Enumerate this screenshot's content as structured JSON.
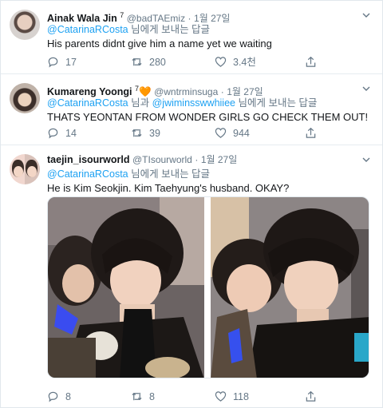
{
  "tweets": [
    {
      "name": "Ainak Wala Jin",
      "name_sup": "7",
      "handle": "@badTAEmiz",
      "date": "1월 27일",
      "reply_mentions": [
        "@CatarinaRCosta"
      ],
      "reply_suffix": "님에게 보내는 답글",
      "text": "His parents didnt give him a name yet we waiting",
      "replies": "17",
      "retweets": "280",
      "likes": "3.4천"
    },
    {
      "name": "Kumareng Yoongi",
      "name_sup": "7",
      "name_emoji": "🧡",
      "handle": "@wntrminsuga",
      "date": "1월 27일",
      "reply_mentions": [
        "@CatarinaRCosta",
        "@jwiminsswwhiiee"
      ],
      "reply_joiner": "님과",
      "reply_suffix": "님에게 보내는 답글",
      "text": "THATS YEONTAN FROM WONDER GIRLS GO CHECK THEM OUT!",
      "replies": "14",
      "retweets": "39",
      "likes": "944"
    },
    {
      "name": "taejin_isourworld",
      "handle": "@TIsourworld",
      "date": "1월 27일",
      "reply_mentions": [
        "@CatarinaRCosta"
      ],
      "reply_suffix": "님에게 보내는 답글",
      "text": "He is Kim Seokjin. Kim Taehyung's husband. OKAY?",
      "replies": "8",
      "retweets": "8",
      "likes": "118"
    }
  ],
  "icons": {
    "reply": "reply-icon",
    "retweet": "retweet-icon",
    "like": "heart-icon",
    "share": "share-icon",
    "more": "chevron-down-icon"
  },
  "colors": {
    "link": "#1da1f2",
    "muted": "#657786",
    "text": "#14171a"
  }
}
